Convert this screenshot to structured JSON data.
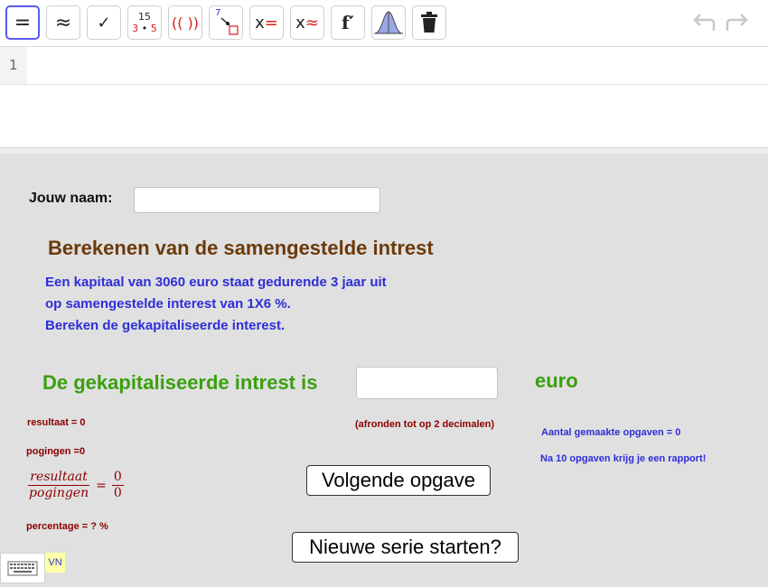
{
  "toolbar": {
    "buttons": {
      "evaluate": "=",
      "numeric": "≈",
      "keep_input": "✓",
      "factor_top": "15",
      "factor_bottom_a": "3",
      "factor_dot": "•",
      "factor_bottom_b": "5",
      "expand": "(( ))",
      "substitute_num": "7",
      "solve_x": "x",
      "solve_eq": "=",
      "nsolve_x": "x",
      "nsolve_eq": "≈",
      "derivative": "f′"
    },
    "accent_color": "#5a5af0"
  },
  "cas": {
    "row_number": "1"
  },
  "applet": {
    "name_label": "Jouw naam:",
    "title": "Berekenen van de samengestelde intrest",
    "problem_lines": [
      "Een kapitaal van 3060 euro staat gedurende 3 jaar uit",
      "op samengestelde interest van 1X6 %.",
      "Bereken de gekapitaliseerde interest."
    ],
    "answer_label": "De gekapitaliseerde intrest is",
    "answer_unit": "euro",
    "rounding_hint": "(afronden tot op 2 decimalen)",
    "resultaat_text": "resultaat = 0",
    "pogingen_text": "pogingen =0",
    "fraction": {
      "left_num": "resultaat",
      "left_den": "pogingen",
      "equals": "=",
      "right_num": "0",
      "right_den": "0"
    },
    "percentage_text": "percentage = ? %",
    "count_text": "Aantal gemaakte opgaven = 0",
    "report_text": "Na 10 opgaven krijg je een rapport!",
    "next_button": "Volgende opgave",
    "new_series_button": "Nieuwe serie starten?",
    "vn_label": "VN"
  }
}
